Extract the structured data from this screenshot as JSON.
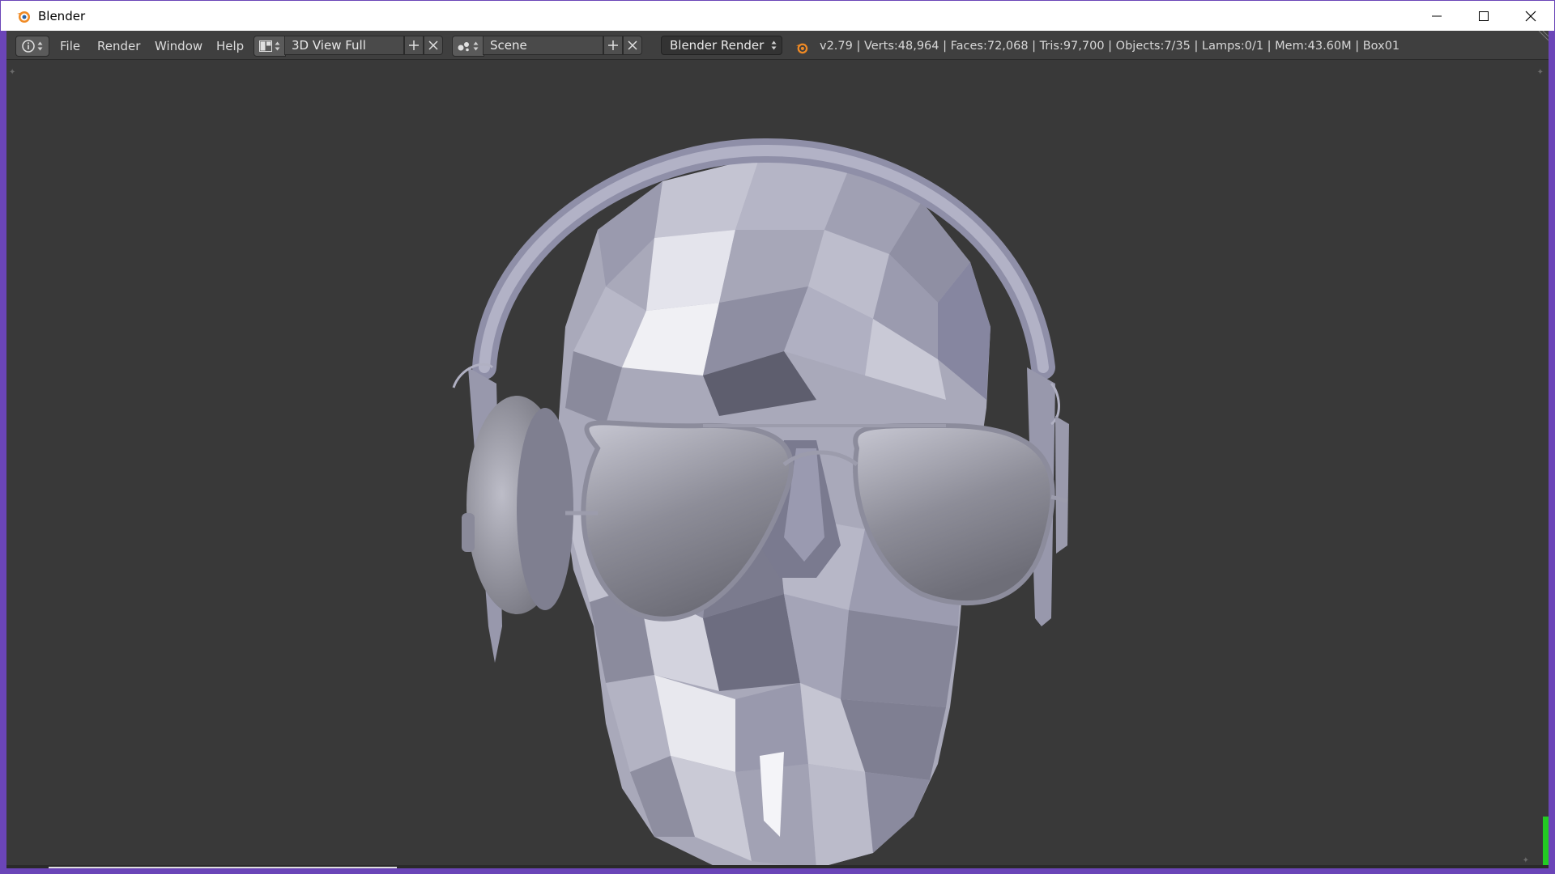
{
  "window": {
    "title": "Blender"
  },
  "menu": {
    "file": "File",
    "render": "Render",
    "window": "Window",
    "help": "Help"
  },
  "screen_layout": {
    "value": "3D View Full"
  },
  "scene": {
    "value": "Scene"
  },
  "render_engine": {
    "value": "Blender Render"
  },
  "stats": {
    "text": "v2.79 | Verts:48,964 | Faces:72,068 | Tris:97,700 | Objects:7/35 | Lamps:0/1 | Mem:43.60M | Box01"
  },
  "viewport": {
    "subject": "low-poly-skull-with-aviator-sunglasses-and-headphones"
  },
  "colors": {
    "window_frame": "#6b45b8",
    "header_bg": "#3f3f3f",
    "viewport_bg": "#393939",
    "text": "#dcdcdc",
    "model_base": "#a9a9ba",
    "scroll_indicator": "#22cc22"
  }
}
